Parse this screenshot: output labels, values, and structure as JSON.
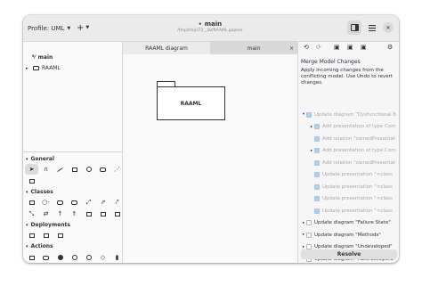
{
  "header": {
    "profile_label": "Profile: UML",
    "add_label": "+",
    "title": "main",
    "subtitle": "/tmp/tmpil72__8z/RAAML.gaphor"
  },
  "tree": {
    "items": [
      {
        "label": "main",
        "icon": "diagram-icon"
      },
      {
        "label": "RAAML",
        "icon": "folder-icon"
      }
    ]
  },
  "toolbox": {
    "sections": [
      "General",
      "Classes",
      "Deployments",
      "Actions"
    ]
  },
  "tabs": [
    {
      "label": "RAAML diagram"
    },
    {
      "label": "main",
      "close": "×"
    }
  ],
  "canvas": {
    "package_label": "RAAML"
  },
  "merge": {
    "title": "Merge Model Changes",
    "description": "Apply incoming changes from the conflicting model. Use Undo to revert changes.",
    "rows": [
      {
        "label": "Update diagram \"Dysfunctional B",
        "checked": true,
        "exp": "▾",
        "indent": 0,
        "dark": false
      },
      {
        "label": "Add presentation of type Com",
        "checked": true,
        "exp": "▸",
        "indent": 1,
        "dark": false
      },
      {
        "label": "Add relation \"ownedPresentat",
        "checked": true,
        "exp": "",
        "indent": 1,
        "dark": false
      },
      {
        "label": "Add presentation of type Com",
        "checked": true,
        "exp": "▸",
        "indent": 1,
        "dark": false
      },
      {
        "label": "Add relation \"ownedPresentat",
        "checked": true,
        "exp": "",
        "indent": 1,
        "dark": false
      },
      {
        "label": "Update presentation \"<class",
        "checked": true,
        "exp": "",
        "indent": 1,
        "dark": false
      },
      {
        "label": "Update presentation \"<class",
        "checked": true,
        "exp": "",
        "indent": 1,
        "dark": false
      },
      {
        "label": "Update presentation \"<class",
        "checked": true,
        "exp": "",
        "indent": 1,
        "dark": false
      },
      {
        "label": "Update presentation \"<class",
        "checked": true,
        "exp": "",
        "indent": 1,
        "dark": false
      },
      {
        "label": "Update diagram \"Failure State\"",
        "checked": false,
        "exp": "▸",
        "indent": 0,
        "dark": true
      },
      {
        "label": "Update diagram \"Methods\"",
        "checked": false,
        "exp": "▸",
        "indent": 0,
        "dark": true
      },
      {
        "label": "Update diagram \"Undeveloped\"",
        "checked": false,
        "exp": "▸",
        "indent": 0,
        "dark": true
      },
      {
        "label": "Update diagram \"AbstractOpera",
        "checked": false,
        "exp": "▸",
        "indent": 0,
        "dark": true
      }
    ],
    "resolve_label": "Resolve"
  }
}
